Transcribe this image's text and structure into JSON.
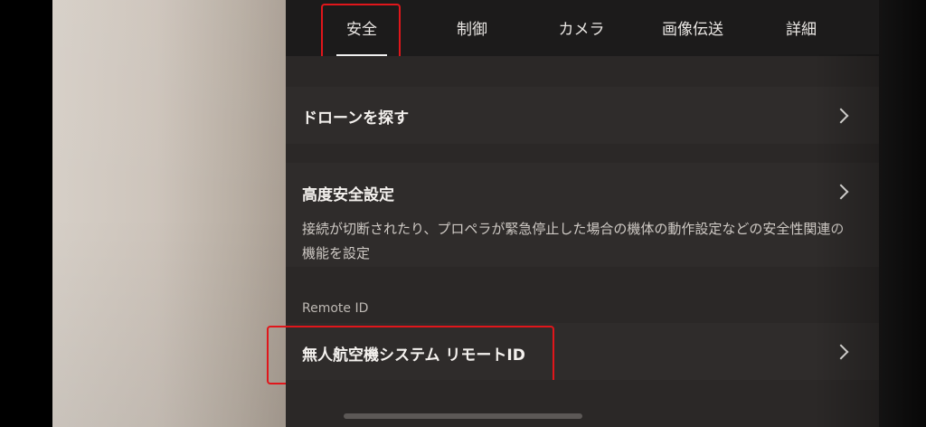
{
  "tabs": [
    {
      "label": "安全",
      "active": true
    },
    {
      "label": "制御",
      "active": false
    },
    {
      "label": "カメラ",
      "active": false
    },
    {
      "label": "画像伝送",
      "active": false
    },
    {
      "label": "詳細",
      "active": false
    }
  ],
  "safety": {
    "find_drone": {
      "title": "ドローンを探す"
    },
    "advanced_safety": {
      "title": "高度安全設定",
      "description": "接続が切断されたり、プロペラが緊急停止した場合の機体の動作設定などの安全性関連の機能を設定"
    },
    "remote_id": {
      "section_label": "Remote ID",
      "title": "無人航空機システム リモートID"
    }
  },
  "colors": {
    "highlight": "#e0161b",
    "panel": "#2f2c2b",
    "tabbar": "#1c1b1b"
  },
  "icons": {
    "row_chevron": "chevron-right-icon"
  }
}
